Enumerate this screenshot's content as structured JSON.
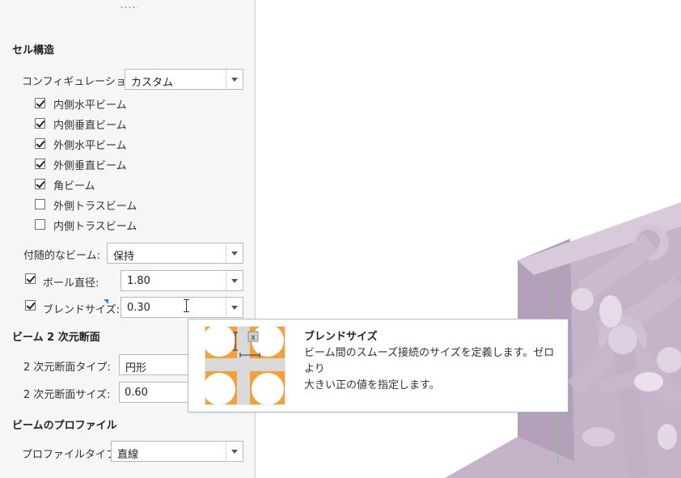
{
  "cell_structure": {
    "title": "セル構造",
    "config_label": "コンフィギュレーション:",
    "config_value": "カスタム",
    "beams": [
      {
        "label": "内側水平ビーム",
        "checked": true
      },
      {
        "label": "内側垂直ビーム",
        "checked": true
      },
      {
        "label": "外側水平ビーム",
        "checked": true
      },
      {
        "label": "外側垂直ビーム",
        "checked": true
      },
      {
        "label": "角ビーム",
        "checked": true
      },
      {
        "label": "外側トラスビーム",
        "checked": false
      },
      {
        "label": "内側トラスビーム",
        "checked": false
      }
    ],
    "incidental_label": "付随的なビーム:",
    "incidental_value": "保持",
    "ball_label": "ボール直径:",
    "ball_checked": true,
    "ball_value": "1.80",
    "blend_label": "ブレンドサイズ:",
    "blend_checked": true,
    "blend_value": "0.30"
  },
  "section2d": {
    "title": "ビーム 2 次元断面",
    "type_label": "2 次元断面タイプ:",
    "type_value": "円形",
    "size_label": "2 次元断面サイズ:",
    "size_value": "0.60"
  },
  "profile": {
    "title": "ビームのプロファイル",
    "type_label": "プロファイルタイプ:",
    "type_value": "直線"
  },
  "tooltip": {
    "title": "ブレンドサイズ",
    "line1": "ビーム間のスムーズ接続のサイズを定義します。ゼロより",
    "line2": "大きい正の値を指定します。",
    "image_mark": "x"
  },
  "colors": {
    "panel_bg": "#f6f6f6",
    "accent": "#1a8fd6",
    "model_fill": "#c9b6cc",
    "tooltip_orange": "#f2a03a"
  },
  "icons": [
    "panel-grip-icon",
    "dropdown-arrow-icon",
    "checkbox-icon",
    "ibeam-cursor-icon",
    "blend-size-illustration"
  ]
}
